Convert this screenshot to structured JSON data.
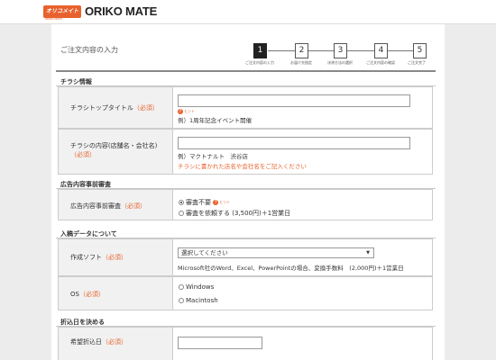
{
  "brand": {
    "logo_mark": "オリコメイト",
    "logo_sub": "ORIKO MATE",
    "name": "ORIKO MATE",
    "accent": "#e8622e"
  },
  "page": {
    "title": "ご注文内容の入力"
  },
  "steps": [
    {
      "num": "1",
      "label": "ご注文内容の入力",
      "active": true
    },
    {
      "num": "2",
      "label": "お届け先指定"
    },
    {
      "num": "3",
      "label": "決済方法の選択"
    },
    {
      "num": "4",
      "label": "ご注文内容の確認"
    },
    {
      "num": "5",
      "label": "ご注文完了"
    }
  ],
  "sections": {
    "flyer": "チラシ情報",
    "review": "広告内容事前審査",
    "data": "入稿データについて",
    "date": "折込日を決める"
  },
  "required": "（必須）",
  "hint_label": "ヒント",
  "fields": {
    "title": {
      "label": "チラシトップタイトル",
      "value": "",
      "example": "例）1周年記念イベント開催"
    },
    "content": {
      "label_line1": "チラシの内容(店舗名・会社名)",
      "label_line2": "",
      "value": "",
      "example": "例）マクトナルト　渋谷店",
      "warning": "チラシに書かれた店名や会社名をご記入ください"
    },
    "review": {
      "label": "広告内容事前審査",
      "option1": "審査不要",
      "option2": "審査を依頼する (3,500円)＋1営業日",
      "selected": 0
    },
    "software": {
      "label": "作成ソフト",
      "placeholder": "選択してください",
      "note": "Microsoft社のWord、Excel、PowerPointの場合、変換手数料　(2,000円)＋1営業日"
    },
    "os": {
      "label": "OS",
      "option1": "Windows",
      "option2": "Macintosh"
    },
    "date": {
      "label": "希望折込日",
      "value": ""
    }
  }
}
